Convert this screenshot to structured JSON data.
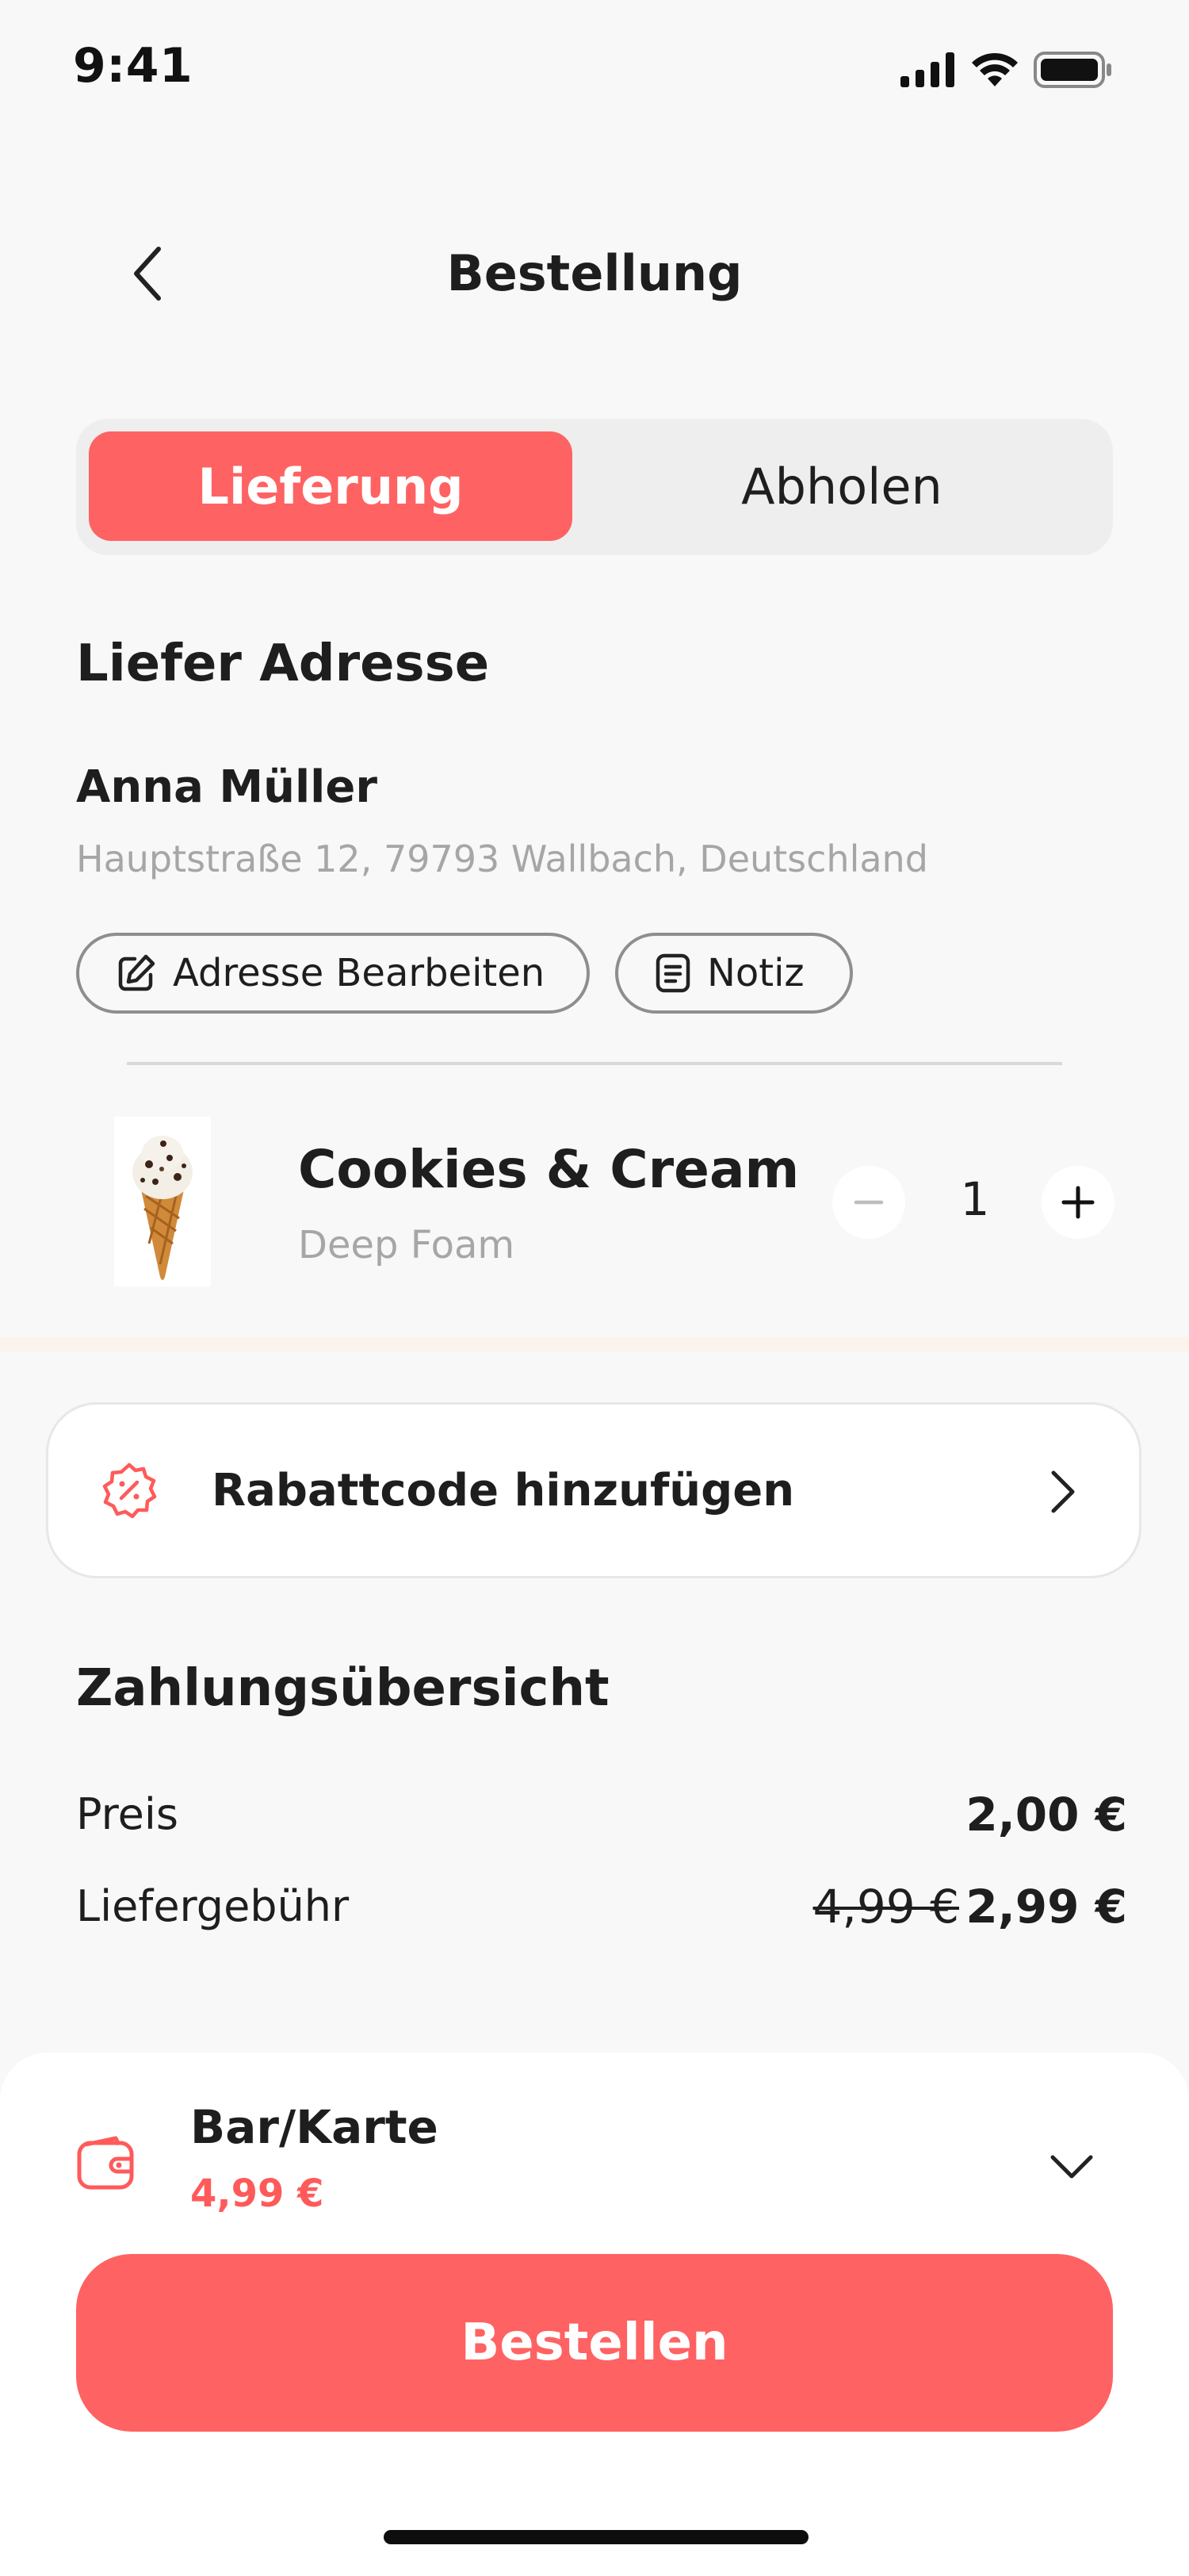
{
  "status": {
    "time": "9:41"
  },
  "header": {
    "title": "Bestellung"
  },
  "tabs": {
    "active": "Lieferung",
    "inactive": "Abholen"
  },
  "address": {
    "section_title": "Liefer Adresse",
    "name": "Anna Müller",
    "line": "Hauptstraße 12, 79793 Wallbach, Deutschland",
    "edit_label": "Adresse Bearbeiten",
    "note_label": "Notiz"
  },
  "product": {
    "name": "Cookies & Cream",
    "subtitle": "Deep Foam",
    "quantity": "1"
  },
  "promo": {
    "label": "Rabattcode hinzufügen"
  },
  "summary": {
    "title": "Zahlungsübersicht",
    "price_label": "Preis",
    "price_value": "2,00 €",
    "delivery_label": "Liefergebühr",
    "delivery_old": "4,99 €",
    "delivery_value": "2,99 €"
  },
  "payment": {
    "method": "Bar/Karte",
    "amount": "4,99 €",
    "order_button": "Bestellen"
  },
  "colors": {
    "accent": "#FF6262",
    "muted_text": "#A6A6A6",
    "segment_bg": "#EEEEEE"
  },
  "icons": [
    "cellular-icon",
    "wifi-icon",
    "battery-icon",
    "chevron-left-icon",
    "edit-icon",
    "note-icon",
    "minus-icon",
    "plus-icon",
    "discount-icon",
    "chevron-right-icon",
    "wallet-icon",
    "chevron-down-icon"
  ]
}
